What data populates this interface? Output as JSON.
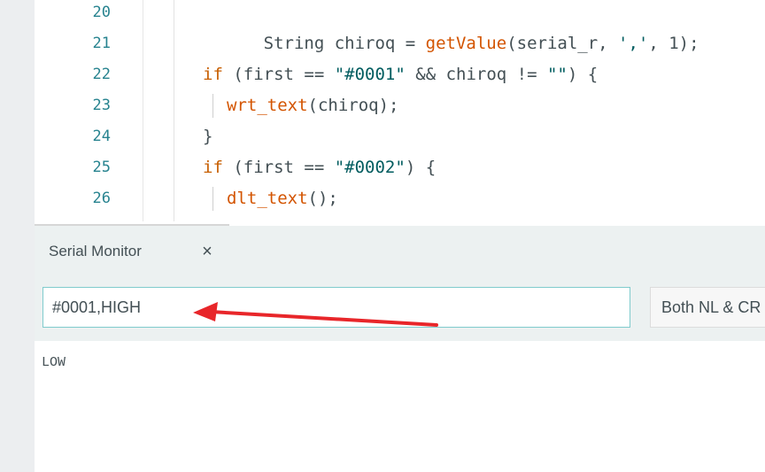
{
  "editor": {
    "lines": [
      {
        "num": "20",
        "code": "String chiroq = getValue(serial_r, ',', 1);"
      },
      {
        "num": "21",
        "code": ""
      },
      {
        "num": "22",
        "code": "if (first == \"#0001\" && chiroq != \"\") {"
      },
      {
        "num": "23",
        "code": "wrt_text(chiroq);"
      },
      {
        "num": "24",
        "code": "}"
      },
      {
        "num": "25",
        "code": "if (first == \"#0002\") {"
      },
      {
        "num": "26",
        "code": "dlt_text();"
      }
    ]
  },
  "serial_monitor": {
    "tab_label": "Serial Monitor",
    "close_icon": "×",
    "input_value": "#0001,HIGH",
    "line_ending": "Both NL & CR",
    "output": "LOW"
  },
  "annotation": {
    "arrow_color": "#e8262a"
  }
}
